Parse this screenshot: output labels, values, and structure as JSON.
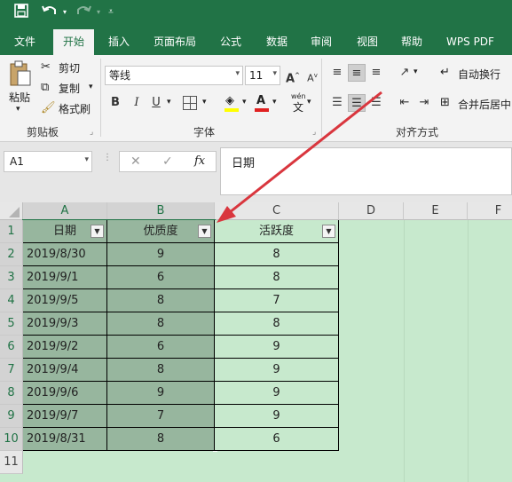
{
  "quick_access": {
    "save_icon": "save-icon",
    "undo_icon": "undo-icon",
    "redo_icon": "redo-icon",
    "customize_icon": "customize-icon"
  },
  "tabs": [
    "文件",
    "开始",
    "插入",
    "页面布局",
    "公式",
    "数据",
    "审阅",
    "视图",
    "帮助",
    "WPS PDF"
  ],
  "active_tab": "开始",
  "ribbon": {
    "clipboard": {
      "paste_label": "粘贴",
      "cut_label": "剪切",
      "copy_label": "复制",
      "format_painter_label": "格式刷",
      "group_name": "剪贴板"
    },
    "font": {
      "font_name": "等线",
      "font_size": "11",
      "grow_label": "A",
      "shrink_label": "A",
      "bold": "B",
      "italic": "I",
      "underline": "U",
      "group_name": "字体",
      "phonetic_label": "wén"
    },
    "alignment": {
      "wrap_text_label": "自动换行",
      "merge_label": "合并后居中",
      "group_name": "对齐方式"
    }
  },
  "formula_bar": {
    "name_box": "A1",
    "fx_label": "fx",
    "content": "日期"
  },
  "sheet": {
    "columns": [
      "A",
      "B",
      "C",
      "D",
      "E",
      "F"
    ],
    "row_numbers": [
      "1",
      "2",
      "3",
      "4",
      "5",
      "6",
      "7",
      "8",
      "9",
      "10",
      "11"
    ],
    "headers": [
      "日期",
      "优质度",
      "活跃度"
    ],
    "rows": [
      [
        "2019/8/30",
        "9",
        "8"
      ],
      [
        "2019/9/1",
        "6",
        "8"
      ],
      [
        "2019/9/5",
        "8",
        "7"
      ],
      [
        "2019/9/3",
        "8",
        "8"
      ],
      [
        "2019/9/2",
        "6",
        "9"
      ],
      [
        "2019/9/4",
        "8",
        "9"
      ],
      [
        "2019/9/6",
        "9",
        "9"
      ],
      [
        "2019/9/7",
        "7",
        "9"
      ],
      [
        "2019/8/31",
        "8",
        "6"
      ]
    ]
  },
  "colors": {
    "accent": "#217346",
    "cell_bg": "#c7e9cd",
    "selected_bg": "#97b69e",
    "annotation_arrow": "#d9363e"
  }
}
